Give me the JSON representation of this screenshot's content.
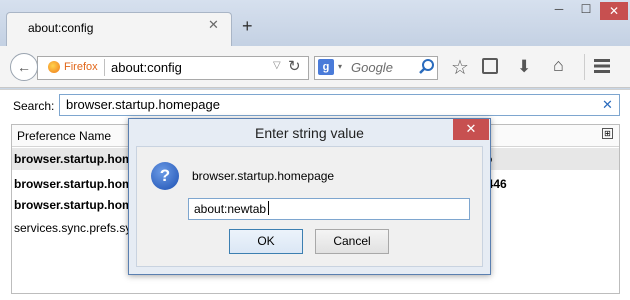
{
  "tab": {
    "title": "about:config"
  },
  "window": {
    "minimize": "─",
    "maximize": "☐",
    "close": "✕"
  },
  "navbar": {
    "identity_label": "Firefox",
    "url": "about:config",
    "search_engine_icon": "g",
    "search_placeholder": "Google"
  },
  "filter": {
    "label": "Search:",
    "value": "browser.startup.homepage"
  },
  "tree": {
    "column_name": "Preference Name",
    "rows": [
      {
        "name": "browser.startup.home",
        "bold": true
      },
      {
        "name": "browser.startup.home",
        "bold": true
      },
      {
        "name": "browser.startup.home",
        "bold": true
      },
      {
        "name": "services.sync.prefs.sy",
        "bold": false
      }
    ],
    "value_fragments": [
      "o",
      "3446"
    ]
  },
  "dialog": {
    "title": "Enter string value",
    "message": "browser.startup.homepage",
    "input_value": "about:newtab",
    "ok_label": "OK",
    "cancel_label": "Cancel",
    "close_glyph": "✕",
    "icon_glyph": "?"
  },
  "icons": {
    "tab_close": "✕",
    "new_tab": "+",
    "back": "←",
    "url_dropdown": "▽",
    "reload": "↻",
    "engine_dropdown": "▾",
    "star": "☆",
    "download": "⬇",
    "home": "⌂",
    "filter_clear": "✕",
    "column_picker": "⊞"
  },
  "colors": {
    "accent_close": "#c75050",
    "firefox_label": "#e16619",
    "focus_border": "#7ea6cf"
  }
}
